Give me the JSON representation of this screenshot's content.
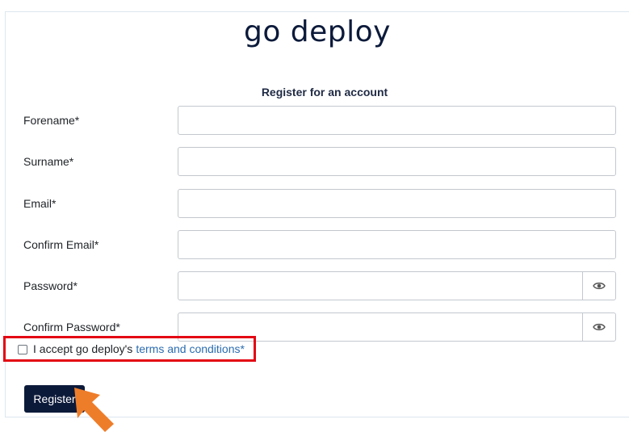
{
  "app": {
    "logo_text": "go deploy"
  },
  "form": {
    "heading": "Register for an account",
    "fields": [
      {
        "label": "Forename*",
        "value": "",
        "placeholder": ""
      },
      {
        "label": "Surname*",
        "value": "",
        "placeholder": ""
      },
      {
        "label": "Email*",
        "value": "",
        "placeholder": ""
      },
      {
        "label": "Confirm Email*",
        "value": "",
        "placeholder": ""
      },
      {
        "label": "Password*",
        "value": "",
        "placeholder": "",
        "icon": "eye-icon"
      },
      {
        "label": "Confirm Password*",
        "value": "",
        "placeholder": "",
        "icon": "eye-icon"
      }
    ],
    "terms": {
      "checked": false,
      "prefix": "I accept go deploy's",
      "link_text": "terms and conditions*"
    },
    "submit_label": "Register"
  },
  "colors": {
    "brand_dark": "#0c1a3a",
    "link": "#2b6cb0",
    "highlight": "#e30613",
    "pointer": "#ee7d2a"
  },
  "annotation": {
    "pointer_icon": "arrow-pointer-icon"
  }
}
